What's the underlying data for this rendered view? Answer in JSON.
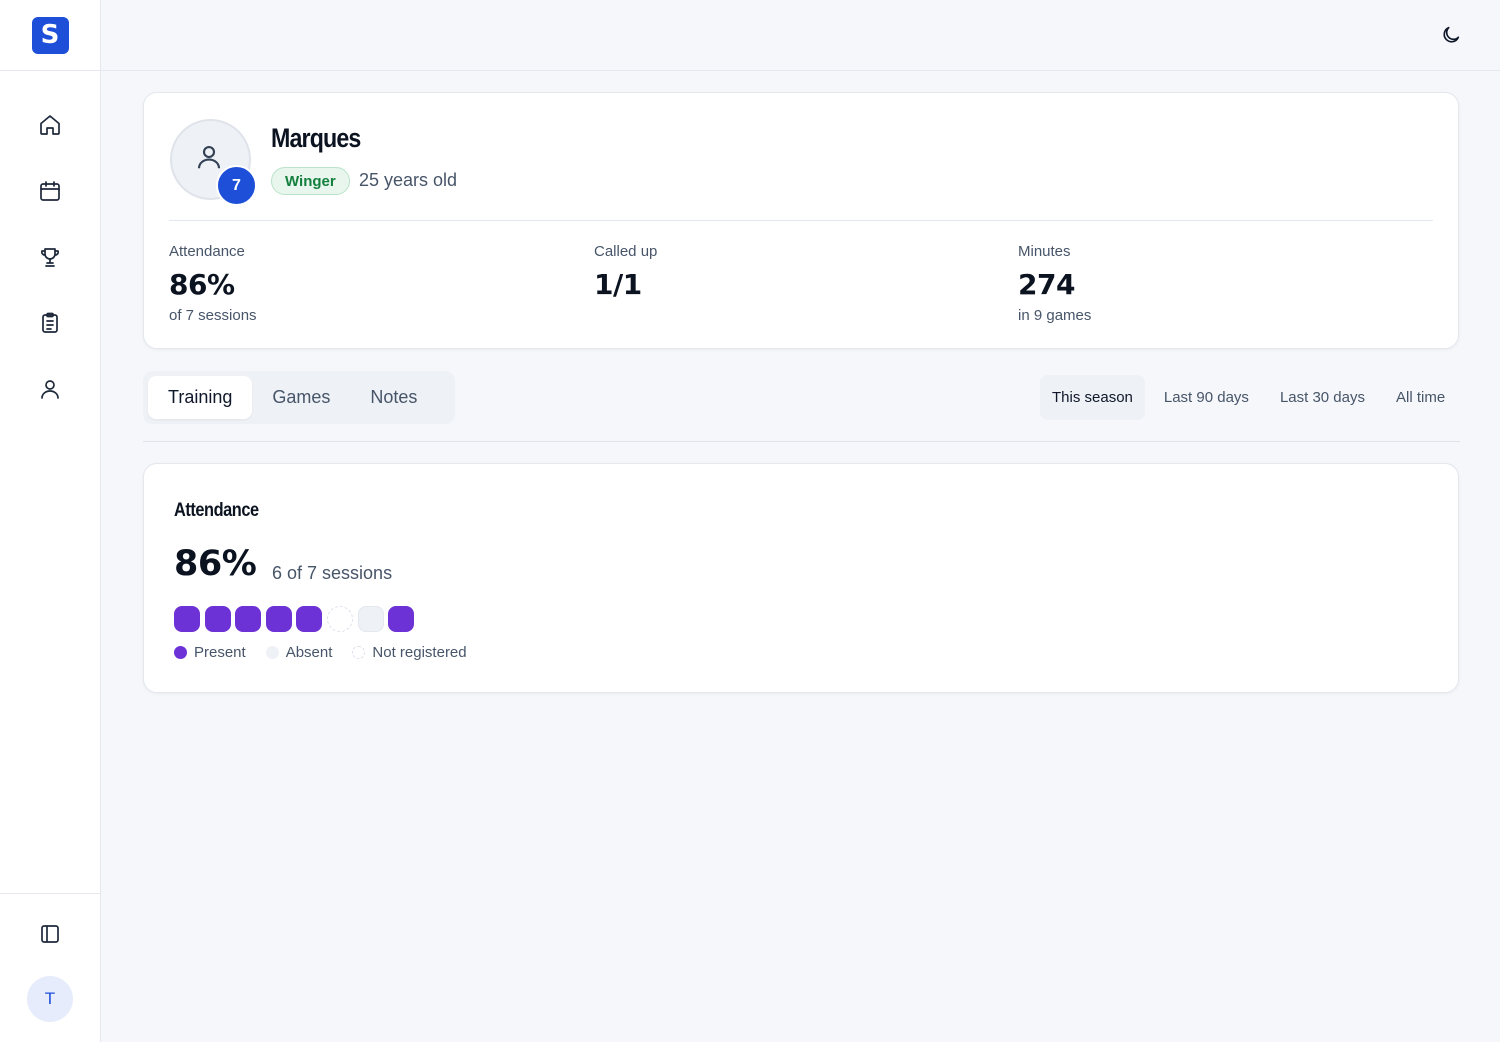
{
  "app": {
    "logo_letter": "S",
    "accent": "#1d4fd8"
  },
  "sidebar": {
    "items": [
      {
        "name": "home",
        "icon": "home-icon"
      },
      {
        "name": "calendar",
        "icon": "calendar-icon"
      },
      {
        "name": "trophy",
        "icon": "trophy-icon"
      },
      {
        "name": "clipboard",
        "icon": "clipboard-list-icon"
      },
      {
        "name": "user",
        "icon": "user-icon"
      }
    ],
    "toggle_icon": "sidebar-panel-icon",
    "user_initial": "T"
  },
  "topbar": {
    "theme_icon": "moon-icon"
  },
  "player": {
    "name": "Marques",
    "number": "7",
    "position": "Winger",
    "age": "25 years old",
    "position_color": "#15803d"
  },
  "stats": [
    {
      "label": "Attendance",
      "value": "86%",
      "sub": "of 7 sessions"
    },
    {
      "label": "Called up",
      "value": "1/1",
      "sub": ""
    },
    {
      "label": "Minutes",
      "value": "274",
      "sub": "in 9 games"
    }
  ],
  "tabs": [
    {
      "label": "Training",
      "active": true
    },
    {
      "label": "Games",
      "active": false
    },
    {
      "label": "Notes",
      "active": false
    }
  ],
  "ranges": [
    {
      "label": "This season",
      "active": true
    },
    {
      "label": "Last 90 days",
      "active": false
    },
    {
      "label": "Last 30 days",
      "active": false
    },
    {
      "label": "All time",
      "active": false
    }
  ],
  "attendance": {
    "title": "Attendance",
    "percent": "86%",
    "summary": "6 of 7 sessions",
    "sessions": [
      "present",
      "present",
      "present",
      "present",
      "present",
      "not_registered",
      "absent",
      "present"
    ],
    "legend": [
      {
        "key": "present",
        "label": "Present"
      },
      {
        "key": "absent",
        "label": "Absent"
      },
      {
        "key": "not_registered",
        "label": "Not registered"
      }
    ],
    "present_color": "#6d32d6"
  }
}
